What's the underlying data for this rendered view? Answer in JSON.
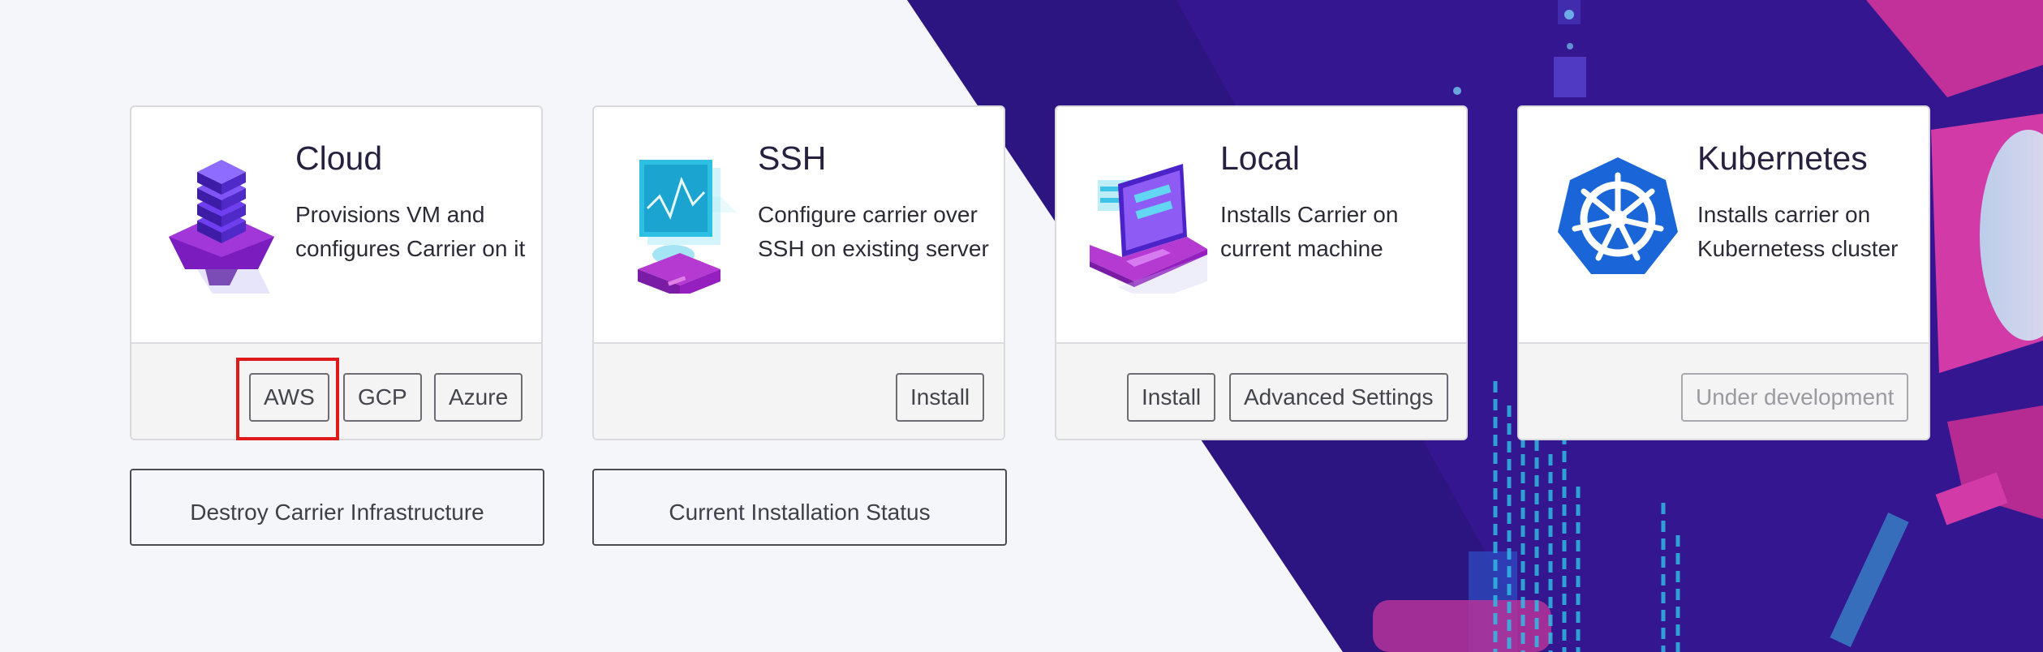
{
  "cards": [
    {
      "title": "Cloud",
      "description": "Provisions VM and configures Carrier on it",
      "buttons": [
        "AWS",
        "GCP",
        "Azure"
      ]
    },
    {
      "title": "SSH",
      "description": "Configure carrier over SSH on existing server",
      "buttons": [
        "Install"
      ]
    },
    {
      "title": "Local",
      "description": "Installs Carrier on current machine",
      "buttons": [
        "Install",
        "Advanced Settings"
      ]
    },
    {
      "title": "Kubernetes",
      "description": "Installs carrier on Kubernetess cluster",
      "buttons": [
        "Under development"
      ]
    }
  ],
  "actions": {
    "destroy_label": "Destroy Carrier Infrastructure",
    "status_label": "Current Installation Status"
  },
  "colors": {
    "background": "#f5f6fa",
    "hero_purple": "#2d1581",
    "accent_magenta": "#d23aa8",
    "accent_cyan": "#3fc3e8",
    "kubernetes_blue": "#1a66d9",
    "highlight_red": "#e0191b"
  }
}
